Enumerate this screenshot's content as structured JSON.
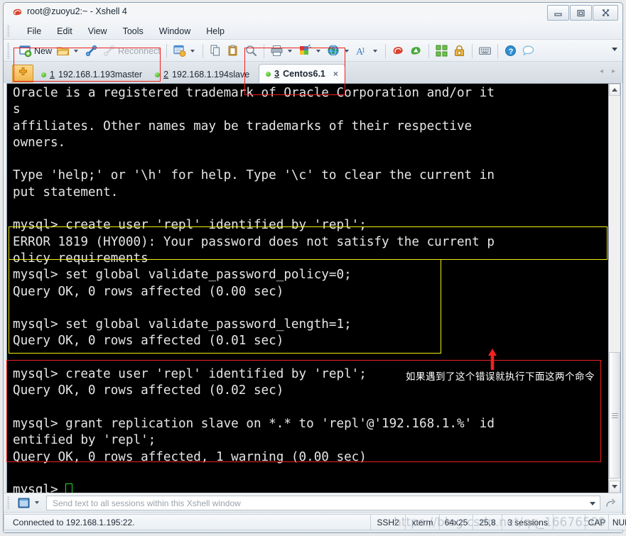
{
  "window": {
    "title": "root@zuoyu2:~ - Xshell 4",
    "icon": "xshell-logo-icon",
    "buttons": {
      "minimize": "minimize-icon",
      "maximize": "maximize-icon",
      "close": "close-icon"
    }
  },
  "menu": {
    "items": [
      "File",
      "Edit",
      "View",
      "Tools",
      "Window",
      "Help"
    ]
  },
  "toolbar": {
    "new_label": "New",
    "reconnect_label": "Reconnect",
    "icons": [
      "new-session-icon",
      "open-folder-icon",
      "link-icon",
      "reconnect-icon",
      "properties-icon",
      "copy-icon",
      "paste-icon",
      "find-icon",
      "print-icon",
      "color-scheme-icon",
      "globe-icon",
      "font-icon",
      "xshell-icon",
      "xftp-icon",
      "arrange-icon",
      "lock-icon",
      "keyboard-icon",
      "help-icon",
      "chat-icon"
    ],
    "overflow": "toolbar-overflow-icon"
  },
  "tabs": {
    "new_tab_icon": "new-tab-icon",
    "items": [
      {
        "num": "1",
        "label": "192.168.1.193master",
        "active": false,
        "status": "connected"
      },
      {
        "num": "2",
        "label": "192.168.1.194slave",
        "active": false,
        "status": "connected"
      },
      {
        "num": "3",
        "label": "Centos6.1",
        "active": true,
        "status": "connected",
        "close": "×"
      }
    ],
    "nav_prev": "◂",
    "nav_next": "▸"
  },
  "terminal": {
    "lines": [
      "Oracle is a registered trademark of Oracle Corporation and/or it",
      "s",
      "affiliates. Other names may be trademarks of their respective",
      "owners.",
      "",
      "Type 'help;' or '\\h' for help. Type '\\c' to clear the current in",
      "put statement.",
      "",
      "mysql> create user 'repl' identified by 'repl';",
      "ERROR 1819 (HY000): Your password does not satisfy the current p",
      "olicy requirements",
      "mysql> set global validate_password_policy=0;",
      "Query OK, 0 rows affected (0.00 sec)",
      "",
      "mysql> set global validate_password_length=1;",
      "Query OK, 0 rows affected (0.01 sec)",
      "",
      "mysql> create user 'repl' identified by 'repl';",
      "Query OK, 0 rows affected (0.02 sec)",
      "",
      "mysql> grant replication slave on *.* to 'repl'@'192.168.1.%' id",
      "entified by 'repl';",
      "Query OK, 0 rows affected, 1 warning (0.00 sec)",
      "",
      "mysql> "
    ],
    "prompt_cursor": "block-cursor"
  },
  "annotations": {
    "chinese_note": "如果遇到了这个错误就执行下面这两个命令",
    "arrow": "red-up-arrow-icon",
    "red_color": "#ef2020",
    "yellow_color": "#f2ef14"
  },
  "sendbar": {
    "icon": "terminal-window-icon",
    "placeholder": "Send text to all sessions within this Xshell window",
    "dropdown": "dropdown-caret-icon",
    "send_icon": "send-icon"
  },
  "statusbar": {
    "connection": "Connected to 192.168.1.195:22.",
    "cells": [
      "SSH2",
      "xterm",
      "64x25",
      "25,8",
      "3 sessions",
      "",
      "CAP",
      "NUM"
    ]
  },
  "watermark": {
    "text": "https://blog.csdn.net/qq_16676509"
  }
}
